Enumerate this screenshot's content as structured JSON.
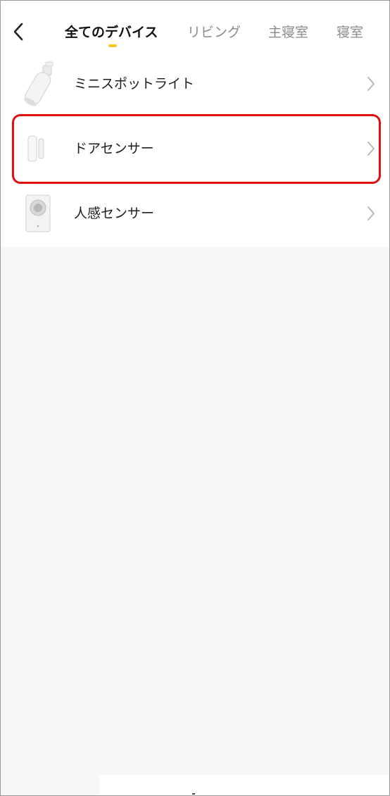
{
  "header": {
    "back_icon": "chevron-left-icon",
    "tabs": [
      {
        "label": "全てのデバイス",
        "active": true
      },
      {
        "label": "リビング",
        "active": false
      },
      {
        "label": "主寝室",
        "active": false
      },
      {
        "label": "寝室",
        "active": false
      }
    ],
    "accent_color": "#f0cd1f"
  },
  "devices": [
    {
      "name": "ミニスポットライト",
      "icon": "spotlight-icon"
    },
    {
      "name": "ドアセンサー",
      "icon": "door-sensor-icon",
      "highlighted": true
    },
    {
      "name": "人感センサー",
      "icon": "motion-sensor-icon"
    }
  ],
  "highlight_color": "#e01010"
}
